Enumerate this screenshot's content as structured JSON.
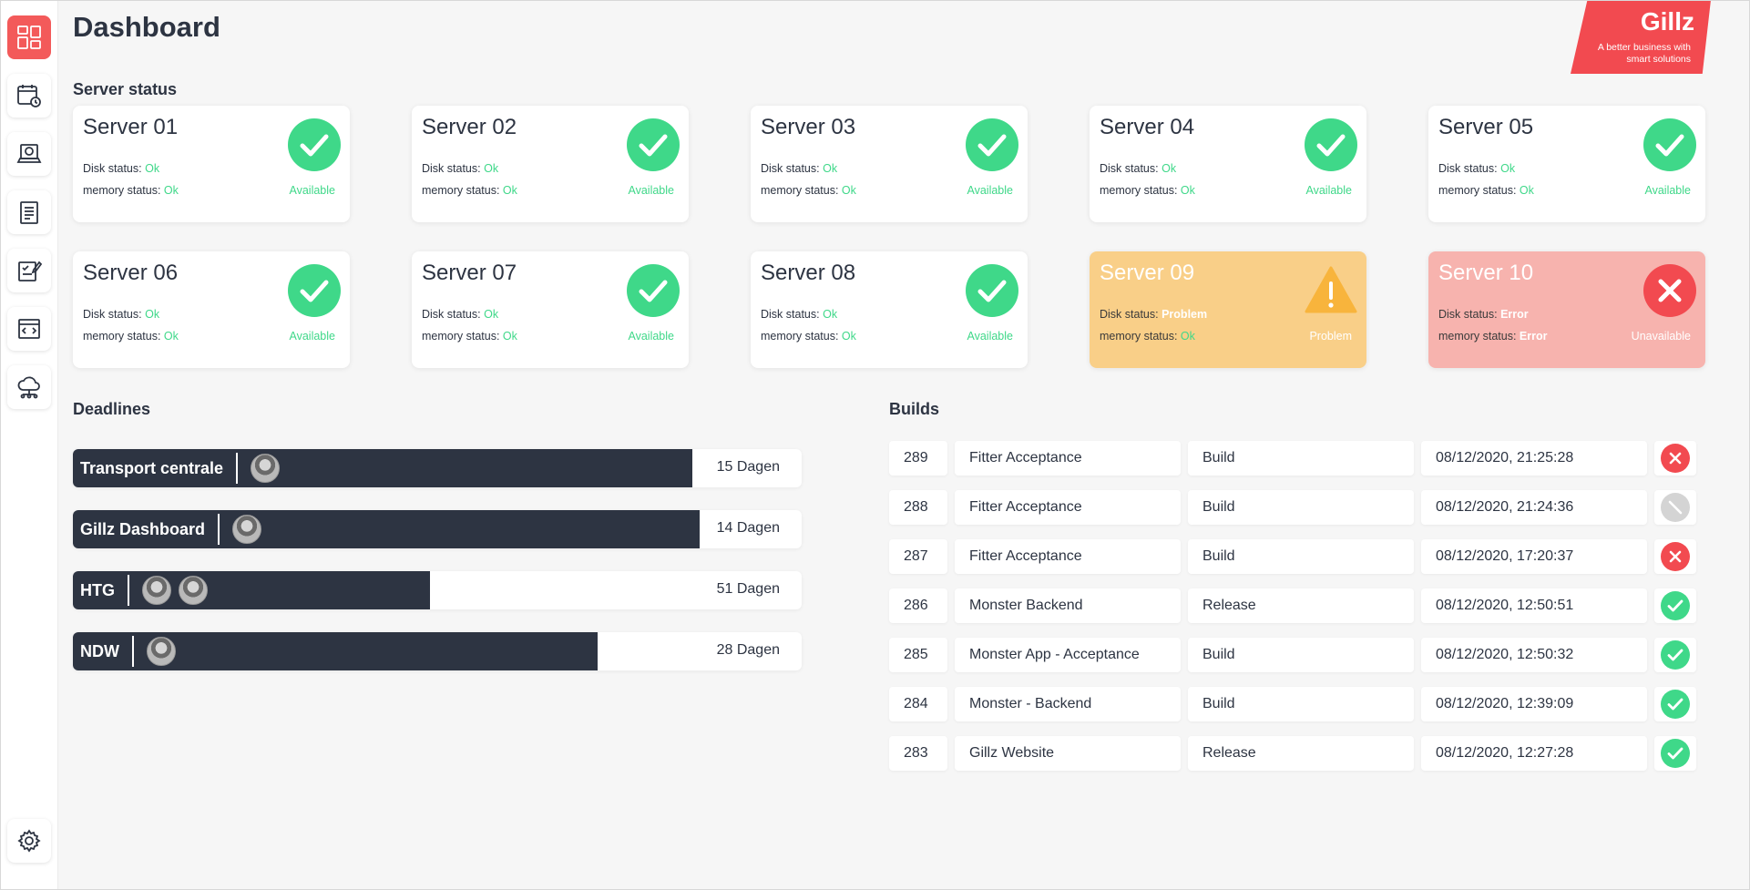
{
  "page": {
    "title": "Dashboard"
  },
  "brand": {
    "name": "Gillz",
    "tagline": "A better business with smart solutions",
    "color": "#f24a50"
  },
  "colors": {
    "ok": "#3fd889",
    "warning": "#f9cf88",
    "error": "#f7b3ae",
    "navy": "#2d3442",
    "accent": "#f35a5a"
  },
  "sidebar": {
    "items": [
      {
        "icon": "dashboard-icon",
        "active": true
      },
      {
        "icon": "calendar-clock-icon",
        "active": false
      },
      {
        "icon": "laptop-icon",
        "active": false
      },
      {
        "icon": "notepad-icon",
        "active": false
      },
      {
        "icon": "checklist-icon",
        "active": false
      },
      {
        "icon": "browser-code-icon",
        "active": false
      },
      {
        "icon": "cloud-network-icon",
        "active": false
      }
    ],
    "settings_icon": "gear-icon"
  },
  "server_status": {
    "heading": "Server status",
    "disk_label": "Disk status:",
    "memory_label": "memory status:",
    "servers": [
      {
        "name": "Server 01",
        "disk": "Ok",
        "memory": "Ok",
        "state": "Available",
        "level": "ok"
      },
      {
        "name": "Server 02",
        "disk": "Ok",
        "memory": "Ok",
        "state": "Available",
        "level": "ok"
      },
      {
        "name": "Server 03",
        "disk": "Ok",
        "memory": "Ok",
        "state": "Available",
        "level": "ok"
      },
      {
        "name": "Server 04",
        "disk": "Ok",
        "memory": "Ok",
        "state": "Available",
        "level": "ok"
      },
      {
        "name": "Server 05",
        "disk": "Ok",
        "memory": "Ok",
        "state": "Available",
        "level": "ok"
      },
      {
        "name": "Server 06",
        "disk": "Ok",
        "memory": "Ok",
        "state": "Available",
        "level": "ok"
      },
      {
        "name": "Server 07",
        "disk": "Ok",
        "memory": "Ok",
        "state": "Available",
        "level": "ok"
      },
      {
        "name": "Server 08",
        "disk": "Ok",
        "memory": "Ok",
        "state": "Available",
        "level": "ok"
      },
      {
        "name": "Server 09",
        "disk": "Problem",
        "memory": "Ok",
        "state": "Problem",
        "level": "warn"
      },
      {
        "name": "Server 10",
        "disk": "Error",
        "memory": "Error",
        "state": "Unavailable",
        "level": "err"
      }
    ]
  },
  "deadlines": {
    "heading": "Deadlines",
    "items": [
      {
        "name": "Transport centrale",
        "days": "15 Dagen",
        "progress": 0.85,
        "avatars": 1
      },
      {
        "name": "Gillz Dashboard",
        "days": "14 Dagen",
        "progress": 0.86,
        "avatars": 1
      },
      {
        "name": "HTG",
        "days": "51 Dagen",
        "progress": 0.49,
        "avatars": 2
      },
      {
        "name": "NDW",
        "days": "28 Dagen",
        "progress": 0.72,
        "avatars": 1
      }
    ]
  },
  "builds": {
    "heading": "Builds",
    "rows": [
      {
        "id": "289",
        "project": "Fitter Acceptance",
        "type": "Build",
        "date": "08/12/2020, 21:25:28",
        "status": "failed"
      },
      {
        "id": "288",
        "project": "Fitter Acceptance",
        "type": "Build",
        "date": "08/12/2020, 21:24:36",
        "status": "cancelled"
      },
      {
        "id": "287",
        "project": "Fitter Acceptance",
        "type": "Build",
        "date": "08/12/2020, 17:20:37",
        "status": "failed"
      },
      {
        "id": "286",
        "project": "Monster Backend",
        "type": "Release",
        "date": "08/12/2020, 12:50:51",
        "status": "success"
      },
      {
        "id": "285",
        "project": "Monster App - Acceptance",
        "type": "Build",
        "date": "08/12/2020, 12:50:32",
        "status": "success"
      },
      {
        "id": "284",
        "project": "Monster - Backend",
        "type": "Build",
        "date": "08/12/2020, 12:39:09",
        "status": "success"
      },
      {
        "id": "283",
        "project": "Gillz Website",
        "type": "Release",
        "date": "08/12/2020, 12:27:28",
        "status": "success"
      }
    ]
  }
}
